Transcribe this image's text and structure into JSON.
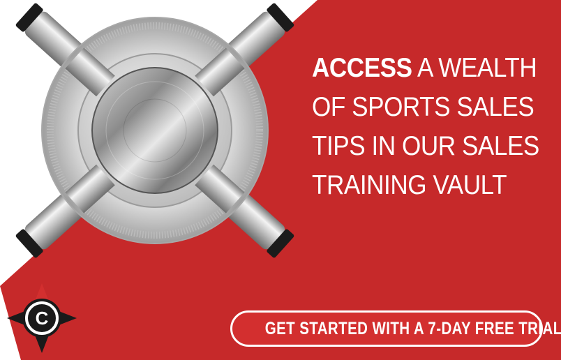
{
  "headline": {
    "emphasis": "ACCESS",
    "line1_rest": "A WEALTH",
    "line2": "OF SPORTS SALES",
    "line3": "TIPS IN OUR SALES",
    "line4": "TRAINING VAULT"
  },
  "cta": {
    "label": "GET STARTED WITH A 7-DAY FREE TRIAL"
  },
  "logo": {
    "letter": "C"
  },
  "colors": {
    "brand_red": "#c6292a",
    "white": "#ffffff",
    "steel": "#c9c9c9",
    "dark": "#1a1a1a"
  },
  "icons": {
    "vault": "vault-door-icon",
    "logo": "compass-logo-icon"
  }
}
